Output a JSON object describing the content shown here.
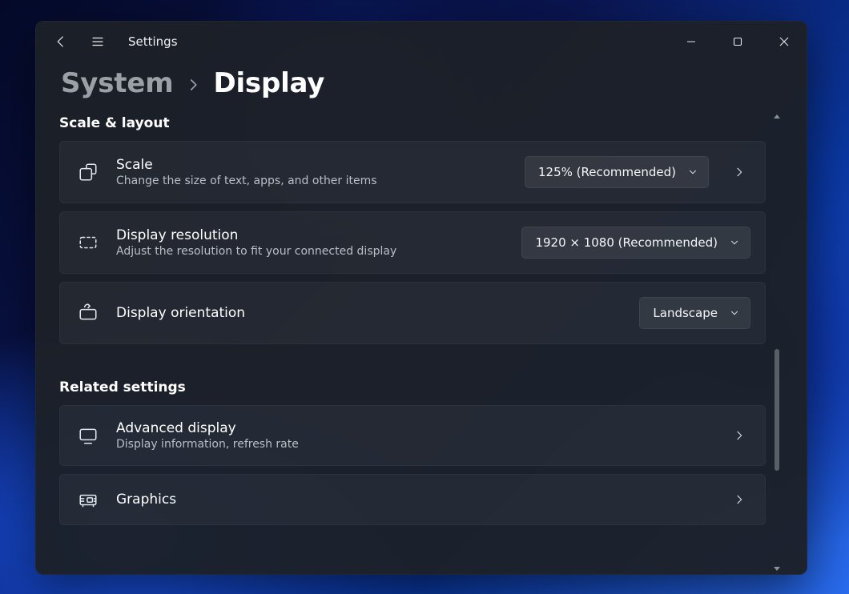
{
  "titlebar": {
    "title": "Settings"
  },
  "breadcrumb": {
    "parent": "System",
    "current": "Display"
  },
  "sections": {
    "scale_layout": {
      "heading": "Scale & layout",
      "scale": {
        "title": "Scale",
        "subtitle": "Change the size of text, apps, and other items",
        "value": "125% (Recommended)"
      },
      "resolution": {
        "title": "Display resolution",
        "subtitle": "Adjust the resolution to fit your connected display",
        "value": "1920 × 1080 (Recommended)"
      },
      "orientation": {
        "title": "Display orientation",
        "value": "Landscape"
      }
    },
    "related": {
      "heading": "Related settings",
      "advanced": {
        "title": "Advanced display",
        "subtitle": "Display information, refresh rate"
      },
      "graphics": {
        "title": "Graphics"
      }
    }
  }
}
